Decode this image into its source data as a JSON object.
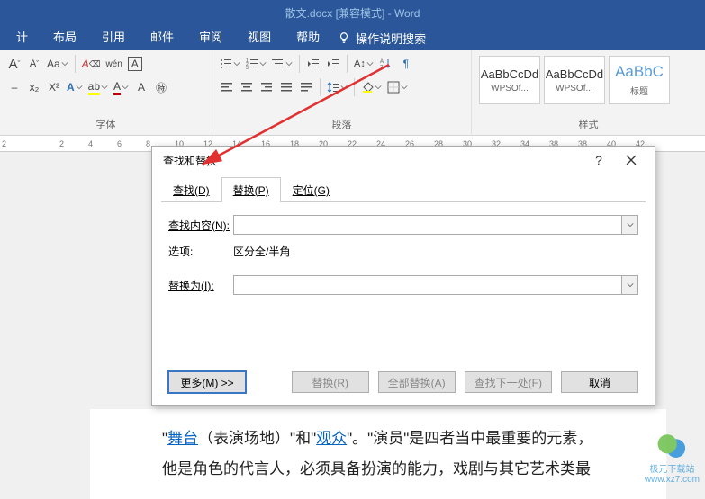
{
  "titlebar": {
    "text": "散文.docx [兼容模式] - Word"
  },
  "tabs": {
    "items": [
      "计",
      "布局",
      "引用",
      "邮件",
      "审阅",
      "视图",
      "帮助"
    ],
    "tellme": "操作说明搜索"
  },
  "font_group": {
    "label": "字体",
    "grow": "A",
    "shrink": "A",
    "clear": "Aa",
    "phonetic": "wén",
    "charborder": "A",
    "sub": "x₂",
    "sup": "X²",
    "texteffect": "A",
    "highlight": "ab",
    "fontcolor": "A",
    "enclose": "㊕"
  },
  "para_group": {
    "label": "段落",
    "show": "¶"
  },
  "styles_group": {
    "label": "样式",
    "items": [
      {
        "sample": "AaBbCcDd",
        "name": "WPSOf..."
      },
      {
        "sample": "AaBbCcDd",
        "name": "WPSOf..."
      },
      {
        "sample": "AaBbC",
        "name": "标题"
      }
    ]
  },
  "ruler": {
    "ticks": [
      "2",
      "",
      "2",
      "4",
      "6",
      "8",
      "10",
      "12",
      "14",
      "16",
      "18",
      "20",
      "22",
      "24",
      "26",
      "28",
      "30",
      "32",
      "34",
      "38",
      "38",
      "40",
      "42"
    ]
  },
  "dialog": {
    "title": "查找和替换",
    "tabs": {
      "find": "查找(D)",
      "replace": "替换(P)",
      "goto": "定位(G)"
    },
    "find_label": "查找内容(N):",
    "options_label": "选项:",
    "options_value": "区分全/半角",
    "replace_label": "替换为(I):",
    "buttons": {
      "more": "更多(M) >>",
      "replace": "替换(R)",
      "replace_all": "全部替换(A)",
      "find_next": "查找下一处(F)",
      "cancel": "取消"
    }
  },
  "doc": {
    "q1": "\"",
    "link1": "舞台",
    "mid1": "（表演场地）\"和\"",
    "link2": "观众",
    "mid2": "\"。\"演员\"是四者当中最重要的元素，",
    "line2": "他是角色的代言人，必须具备扮演的能力，戏剧与其它艺术类最"
  },
  "watermark": {
    "site": "www.xz7.com",
    "name": "极元下载站"
  }
}
